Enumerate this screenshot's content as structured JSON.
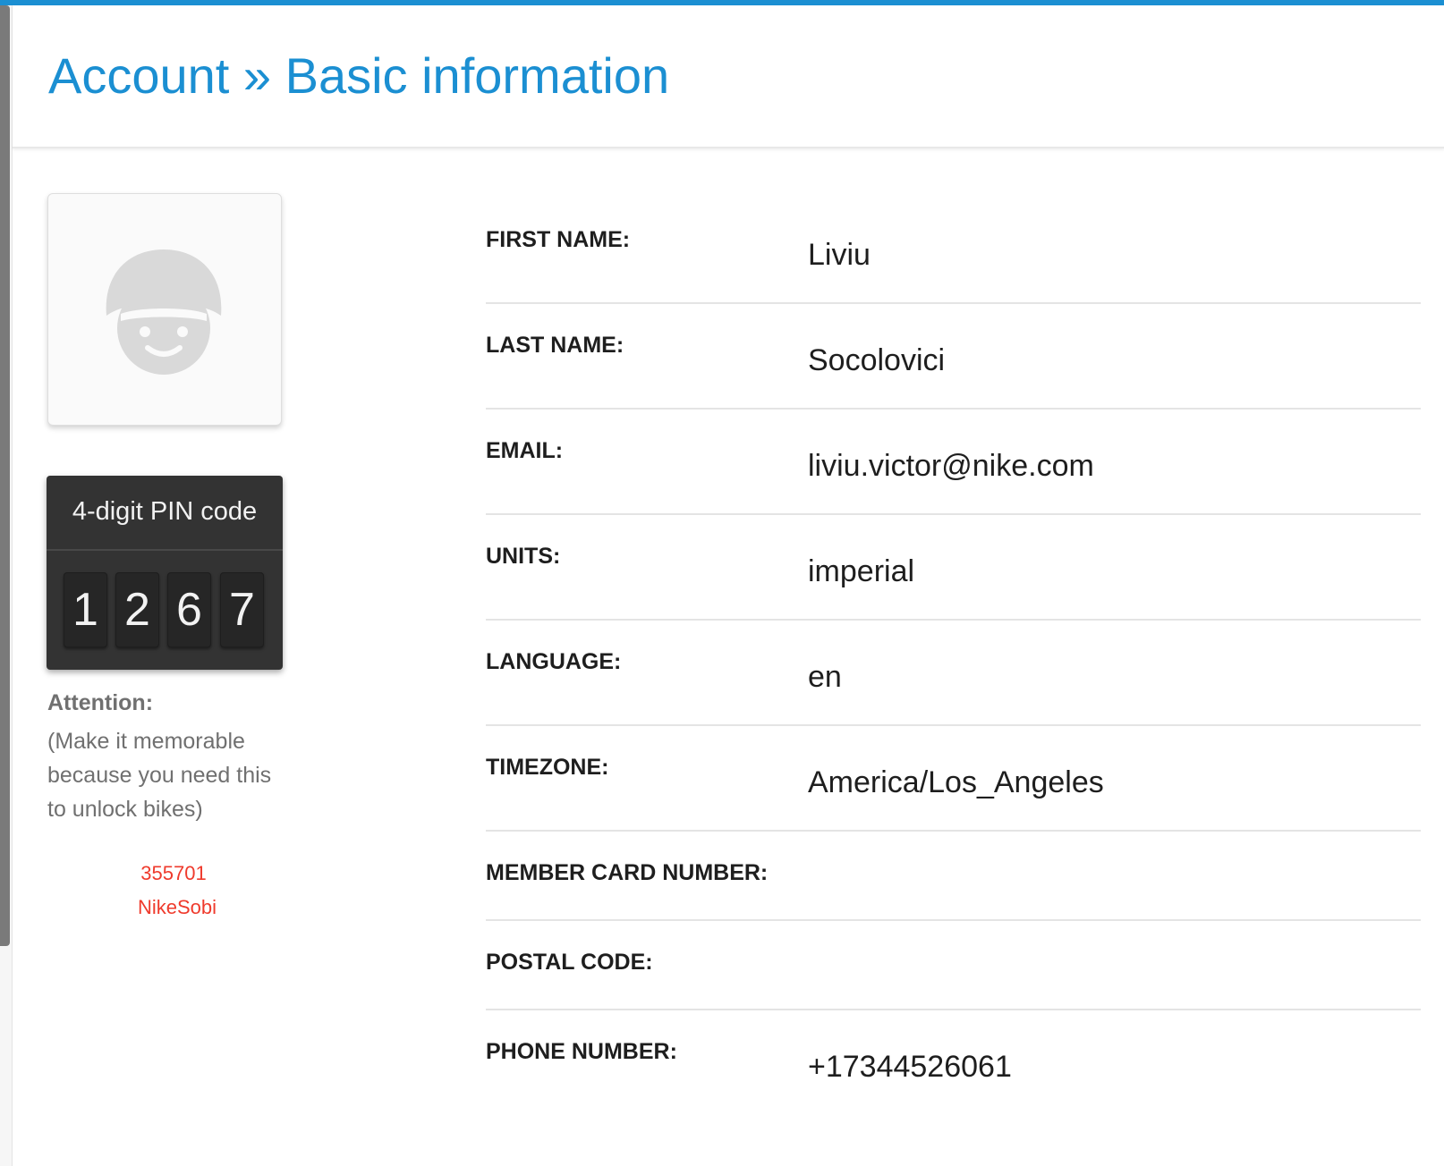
{
  "header": {
    "title": "Account » Basic information"
  },
  "colors": {
    "accent": "#1b8fd2",
    "warning_text": "#ef3a2c",
    "pin_background": "#333333"
  },
  "avatar": {
    "icon": "helmet-avatar-icon"
  },
  "pin": {
    "title": "4-digit PIN code",
    "digits": [
      "1",
      "2",
      "6",
      "7"
    ]
  },
  "attention": {
    "label": "Attention:",
    "text": "(Make it memorable because you need this to unlock bikes)"
  },
  "member": {
    "code": "355701",
    "name": "NikeSobi"
  },
  "fields": [
    {
      "label": "FIRST NAME:",
      "value": "Liviu"
    },
    {
      "label": "LAST NAME:",
      "value": "Socolovici"
    },
    {
      "label": "EMAIL:",
      "value": "liviu.victor@nike.com"
    },
    {
      "label": "UNITS:",
      "value": "imperial"
    },
    {
      "label": "LANGUAGE:",
      "value": "en"
    },
    {
      "label": "TIMEZONE:",
      "value": "America/Los_Angeles"
    },
    {
      "label": "MEMBER CARD NUMBER:",
      "value": ""
    },
    {
      "label": "POSTAL CODE:",
      "value": ""
    },
    {
      "label": "PHONE NUMBER:",
      "value": "+17344526061"
    }
  ]
}
